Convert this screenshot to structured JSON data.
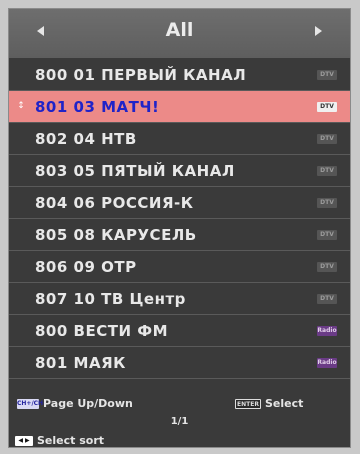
{
  "header": {
    "title": "All"
  },
  "channels": [
    {
      "label": "800 01 ПЕРВЫЙ КАНАЛ",
      "badge": "DTV",
      "type": "dtv",
      "selected": false
    },
    {
      "label": "801 03 МАТЧ!",
      "badge": "DTV",
      "type": "dtv",
      "selected": true
    },
    {
      "label": "802 04 НТВ",
      "badge": "DTV",
      "type": "dtv",
      "selected": false
    },
    {
      "label": "803 05 ПЯТЫЙ КАНАЛ",
      "badge": "DTV",
      "type": "dtv",
      "selected": false
    },
    {
      "label": "804 06 РОССИЯ-К",
      "badge": "DTV",
      "type": "dtv",
      "selected": false
    },
    {
      "label": "805 08 КАРУСЕЛЬ",
      "badge": "DTV",
      "type": "dtv",
      "selected": false
    },
    {
      "label": "806 09 ОТР",
      "badge": "DTV",
      "type": "dtv",
      "selected": false
    },
    {
      "label": "807 10 ТВ Центр",
      "badge": "DTV",
      "type": "dtv",
      "selected": false
    },
    {
      "label": "800 ВЕСТИ ФМ",
      "badge": "Radio",
      "type": "radio",
      "selected": false
    },
    {
      "label": "801 МАЯК",
      "badge": "Radio",
      "type": "radio",
      "selected": false
    }
  ],
  "footer": {
    "ch_key": "CH+/CH-",
    "page_label": "Page Up/Down",
    "enter_key": "ENTER",
    "select_label": "Select",
    "page_count": "1/1",
    "arrow_key": "◀ ▶",
    "sort_label": "Select sort"
  },
  "colors": {
    "panel": "#3a3a3a",
    "header": "#666666",
    "selected_row": "#ec8a88",
    "selected_text": "#1f23c8",
    "radio_badge": "#6a3b86"
  }
}
